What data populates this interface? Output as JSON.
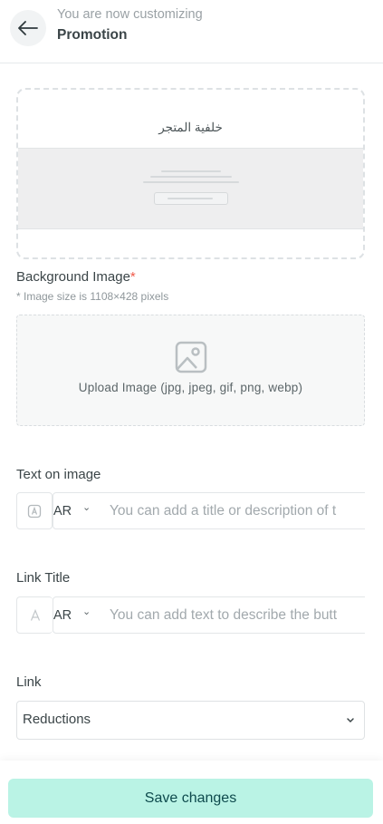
{
  "header": {
    "subtitle": "You are now customizing",
    "title": "Promotion"
  },
  "preview": {
    "label": "خلفية المتجر"
  },
  "background_image": {
    "label": "Background Image",
    "required_mark": "*",
    "hint": "* Image size is 1108×428 pixels",
    "upload_text": "Upload Image (jpg, jpeg, gif, png, webp)"
  },
  "text_on_image": {
    "label": "Text on image",
    "lang": "AR",
    "placeholder": "You can add a title or description of t"
  },
  "link_title": {
    "label": "Link Title",
    "lang": "AR",
    "placeholder": "You can add text to describe the butt"
  },
  "link": {
    "label": "Link",
    "value": "Reductions"
  },
  "footer": {
    "save_label": "Save changes"
  },
  "icons": {
    "back": "arrow-left-icon",
    "image": "image-icon",
    "text_format": "text-format-icon",
    "chevron": "chevron-down-icon"
  },
  "colors": {
    "accent": "#baf3e5",
    "accent_text": "#0e4a4d",
    "required": "#f05a4a"
  }
}
